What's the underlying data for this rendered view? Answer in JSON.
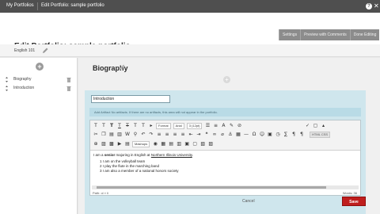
{
  "breadcrumbs": [
    "My Portfolios",
    "Edit Portfolio: sample portfolio"
  ],
  "header": {
    "buttons": [
      "Settings",
      "Preview with Comments",
      "Done Editing"
    ],
    "title": "Edit Portfolio: sample portfolio",
    "course": "English 101"
  },
  "sidebar": {
    "items": [
      {
        "label": "Biography"
      },
      {
        "label": "Introduction"
      }
    ]
  },
  "main": {
    "section_title": "Biography",
    "panel": {
      "input_value": "Introduction",
      "info_text": "Add Artifact  No artifacts. If there are no artifacts, this area will not appear in the portfolio."
    },
    "editor": {
      "format_label": "Format",
      "font_label": "Arial",
      "size_label": "3 (12pt)",
      "style_label": "Mashups",
      "html_tag": "HTML CSS",
      "text_prefix": "I am a ",
      "text_bold": "senior",
      "text_middle": " majoring in English at ",
      "text_link": "Northern Illinois University",
      "text_suffix": ".",
      "list": [
        "1  I am on the volleyball team",
        "2  I play the flute in the marching band",
        "3  I am also a member of a national honors society"
      ],
      "path_label": "Path: ol » li",
      "words_label": "Words: 36"
    },
    "cancel_label": "Cancel",
    "save_label": "Save"
  },
  "colors": {
    "topbar": "#4f4f4f",
    "panel": "#cfe6ed",
    "save": "#bf1e1e"
  }
}
